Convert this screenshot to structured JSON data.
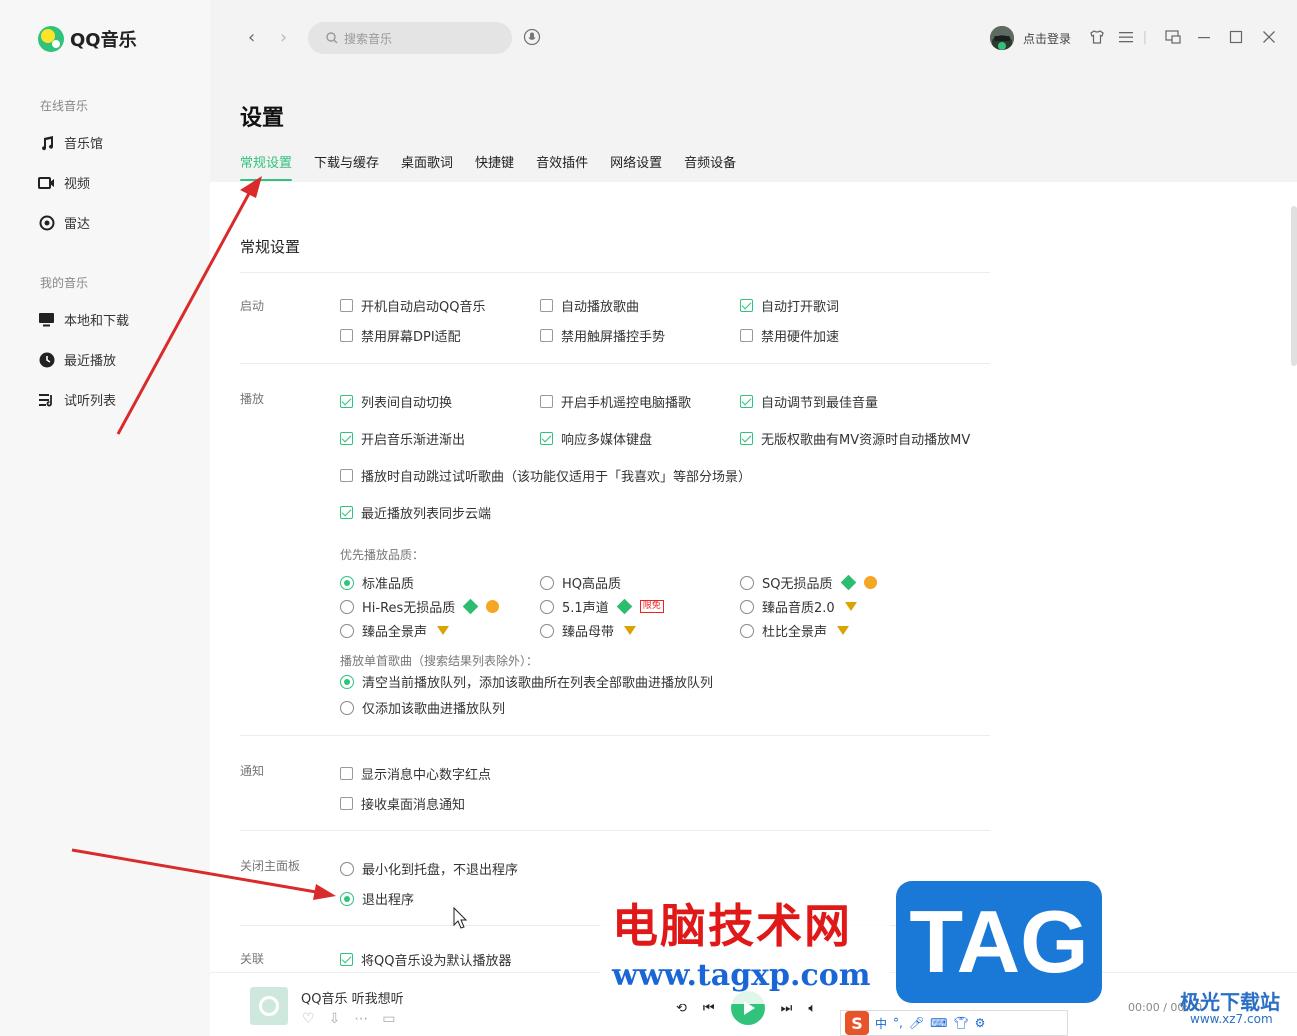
{
  "app": {
    "name": "QQ音乐"
  },
  "sidebar": {
    "online_section": "在线音乐",
    "online_items": [
      {
        "label": "音乐馆",
        "icon": "music-note-icon"
      },
      {
        "label": "视频",
        "icon": "video-icon"
      },
      {
        "label": "雷达",
        "icon": "radar-icon"
      }
    ],
    "my_section": "我的音乐",
    "my_items": [
      {
        "label": "本地和下载",
        "icon": "monitor-icon"
      },
      {
        "label": "最近播放",
        "icon": "clock-icon"
      },
      {
        "label": "试听列表",
        "icon": "playlist-icon"
      }
    ]
  },
  "topbar": {
    "search_placeholder": "搜索音乐",
    "login_label": "点击登录"
  },
  "settings": {
    "title": "设置",
    "tabs": [
      "常规设置",
      "下载与缓存",
      "桌面歌词",
      "快捷键",
      "音效插件",
      "网络设置",
      "音频设备"
    ],
    "active_tab": "常规设置",
    "section_title": "常规设置",
    "startup": {
      "label": "启动",
      "options": [
        {
          "label": "开机自动启动QQ音乐",
          "checked": false
        },
        {
          "label": "自动播放歌曲",
          "checked": false
        },
        {
          "label": "自动打开歌词",
          "checked": true
        },
        {
          "label": "禁用屏幕DPI适配",
          "checked": false
        },
        {
          "label": "禁用触屏播控手势",
          "checked": false
        },
        {
          "label": "禁用硬件加速",
          "checked": false
        }
      ]
    },
    "playback": {
      "label": "播放",
      "options": [
        {
          "label": "列表间自动切换",
          "checked": true
        },
        {
          "label": "开启手机遥控电脑播歌",
          "checked": false
        },
        {
          "label": "自动调节到最佳音量",
          "checked": true
        },
        {
          "label": "开启音乐渐进渐出",
          "checked": true
        },
        {
          "label": "响应多媒体键盘",
          "checked": true
        },
        {
          "label": "无版权歌曲有MV资源时自动播放MV",
          "checked": true
        },
        {
          "label": "播放时自动跳过试听歌曲（该功能仅适用于「我喜欢」等部分场景）",
          "checked": false
        },
        {
          "label": "最近播放列表同步云端",
          "checked": true
        }
      ],
      "quality_label": "优先播放品质：",
      "quality_options": [
        {
          "label": "标准品质",
          "selected": true
        },
        {
          "label": "HQ高品质",
          "selected": false
        },
        {
          "label": "SQ无损品质",
          "selected": false
        },
        {
          "label": "Hi-Res无损品质",
          "selected": false
        },
        {
          "label": "5.1声道",
          "selected": false,
          "tag": "限免"
        },
        {
          "label": "臻品音质2.0",
          "selected": false
        },
        {
          "label": "臻品全景声",
          "selected": false
        },
        {
          "label": "臻品母带",
          "selected": false
        },
        {
          "label": "杜比全景声",
          "selected": false
        }
      ],
      "single_label": "播放单首歌曲（搜索结果列表除外）：",
      "single_options": [
        {
          "label": "清空当前播放队列，添加该歌曲所在列表全部歌曲进播放队列",
          "selected": true
        },
        {
          "label": "仅添加该歌曲进播放队列",
          "selected": false
        }
      ]
    },
    "notify": {
      "label": "通知",
      "options": [
        {
          "label": "显示消息中心数字红点",
          "checked": false
        },
        {
          "label": "接收桌面消息通知",
          "checked": false
        }
      ]
    },
    "close_panel": {
      "label": "关闭主面板",
      "options": [
        {
          "label": "最小化到托盘，不退出程序",
          "selected": false
        },
        {
          "label": "退出程序",
          "selected": true
        }
      ]
    },
    "assoc": {
      "label": "关联",
      "options": [
        {
          "label": "将QQ音乐设为默认播放器",
          "checked": true
        }
      ]
    }
  },
  "player": {
    "song": "QQ音乐 听我想听",
    "time": "00:00 / 00:00"
  },
  "watermark": {
    "title": "电脑技术网",
    "url": "www.tagxp.com",
    "tag": "TAG",
    "corner": "极光下载站",
    "corner_url": "www.xz7.com"
  },
  "ime": {
    "logo": "S",
    "mode": "中"
  },
  "colors": {
    "accent": "#31c27c",
    "annotation": "#d92b2b"
  }
}
